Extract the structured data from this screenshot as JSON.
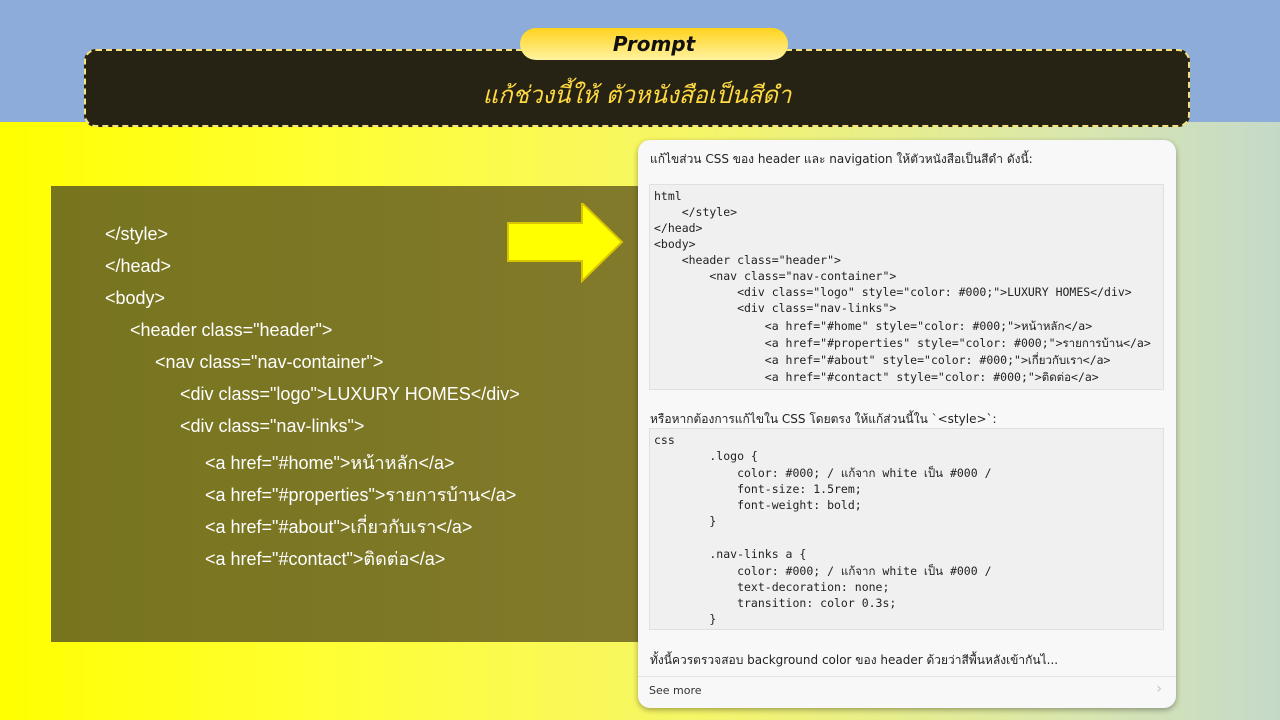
{
  "prompt": {
    "pill_label": "Prompt",
    "text": "แก้ช่วงนี้ให้ ตัวหนังสือเป็นสีดำ"
  },
  "code_panel": {
    "lines": [
      "</style>",
      "</head>",
      "<body>",
      "<header class=\"header\">",
      "<nav class=\"nav-container\">",
      "<div class=\"logo\">LUXURY HOMES</div>",
      "<div class=\"nav-links\">",
      "<a href=\"#home\">หน้าหลัก</a>",
      "<a href=\"#properties\">รายการบ้าน</a>",
      "<a href=\"#about\">เกี่ยวกับเรา</a>",
      "<a href=\"#contact\">ติดต่อ</a>"
    ]
  },
  "chat": {
    "intro": "แก้ไขส่วน CSS ของ header และ navigation ให้ตัวหนังสือเป็นสีดำ ดังนี้:",
    "html_block": [
      "html",
      "    </style>",
      "</head>",
      "<body>",
      "    <header class=\"header\">",
      "        <nav class=\"nav-container\">",
      "            <div class=\"logo\" style=\"color: #000;\">LUXURY HOMES</div>",
      "            <div class=\"nav-links\">",
      "                <a href=\"#home\" style=\"color: #000;\">หน้าหลัก</a>",
      "                <a href=\"#properties\" style=\"color: #000;\">รายการบ้าน</a>",
      "                <a href=\"#about\" style=\"color: #000;\">เกี่ยวกับเรา</a>",
      "                <a href=\"#contact\" style=\"color: #000;\">ติดต่อ</a>"
    ],
    "middle": "หรือหากต้องการแก้ไขใน CSS โดยตรง ให้แก้ส่วนนี้ใน `<style>`:",
    "css_block": [
      "css",
      "        .logo {",
      "            color: #000; / แก้จาก white เป็น #000 /",
      "            font-size: 1.5rem;",
      "            font-weight: bold;",
      "        }",
      "",
      "        .nav-links a {",
      "            color: #000; / แก้จาก white เป็น #000 /",
      "            text-decoration: none;",
      "            transition: color 0.3s;",
      "        }"
    ],
    "footer": "ทั้งนี้ควรตรวจสอบ background color ของ header ด้วยว่าสีพื้นหลังเข้ากันไ...",
    "see_more": "See more",
    "chevron": "›"
  }
}
